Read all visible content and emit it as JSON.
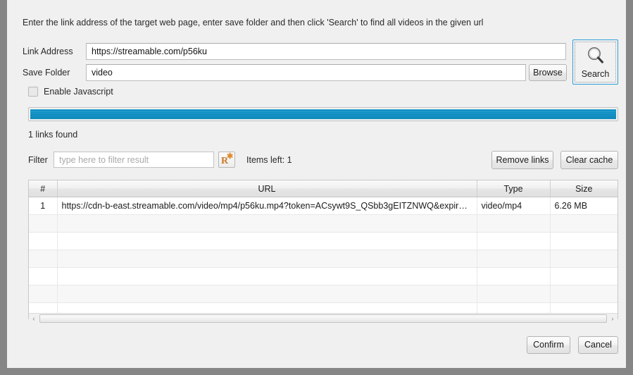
{
  "dialog": {
    "instruction": "Enter the link address of the target web page, enter save folder and then click 'Search' to find all videos in the given url"
  },
  "form": {
    "link_label": "Link Address",
    "link_value": "https://streamable.com/p56ku",
    "folder_label": "Save Folder",
    "folder_value": "video",
    "browse_label": "Browse",
    "search_label": "Search",
    "search_icon": "magnifier-icon",
    "javascript_label": "Enable Javascript",
    "javascript_checked": false
  },
  "progress": {
    "percent": 100,
    "status_text": "1 links found",
    "fill_color": "#0b8cc0"
  },
  "filter": {
    "label": "Filter",
    "placeholder": "type here to filter result",
    "value": "",
    "regex_icon": "regex-r-asterisk-icon",
    "items_left": "Items left: 1",
    "remove_links_label": "Remove links",
    "clear_cache_label": "Clear cache"
  },
  "table": {
    "columns": [
      "#",
      "URL",
      "Type",
      "Size"
    ],
    "rows": [
      {
        "num": "1",
        "url": "https://cdn-b-east.streamable.com/video/mp4/p56ku.mp4?token=ACsywt9S_QSbb3gEITZNWQ&expires…",
        "type": "video/mp4",
        "size": "6.26 MB"
      }
    ],
    "empty_row_count": 6
  },
  "scrollbar": {
    "left_arrow": "‹",
    "right_arrow": "›"
  },
  "footer": {
    "confirm_label": "Confirm",
    "cancel_label": "Cancel"
  }
}
